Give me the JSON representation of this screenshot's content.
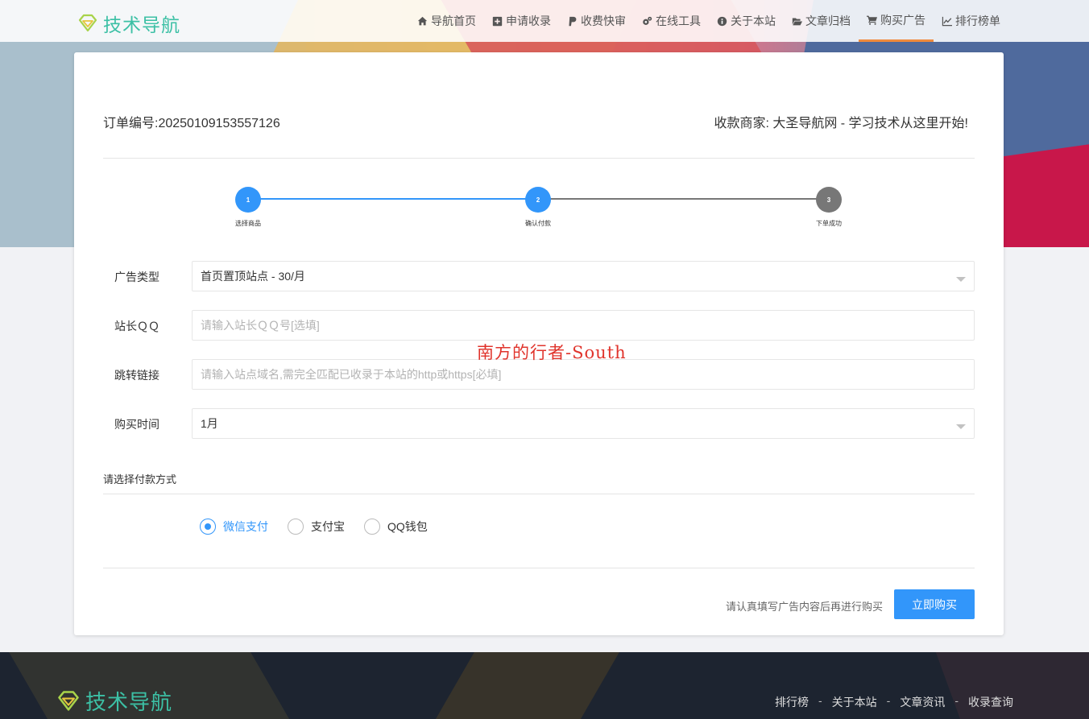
{
  "brand": {
    "name": "技术导航"
  },
  "nav": {
    "items": [
      {
        "label": "导航首页",
        "icon": "home-icon"
      },
      {
        "label": "申请收录",
        "icon": "plus-square-icon"
      },
      {
        "label": "收费快审",
        "icon": "paypal-icon"
      },
      {
        "label": "在线工具",
        "icon": "gears-icon"
      },
      {
        "label": "关于本站",
        "icon": "info-circle-icon"
      },
      {
        "label": "文章归档",
        "icon": "folder-open-icon"
      },
      {
        "label": "购买广告",
        "icon": "shopping-cart-icon",
        "active": true
      },
      {
        "label": "排行榜单",
        "icon": "line-chart-icon"
      }
    ]
  },
  "order": {
    "number": "订单编号:20250109153557126",
    "merchant": "收款商家: 大圣导航网 - 学习技术从这里开始!"
  },
  "steps": [
    {
      "num": "1",
      "label": "选择商品",
      "done": true
    },
    {
      "num": "2",
      "label": "确认付款",
      "done": true
    },
    {
      "num": "3",
      "label": "下单成功",
      "done": false
    }
  ],
  "form": {
    "ad_type": {
      "label": "广告类型",
      "value": "首页置顶站点 - 30/月"
    },
    "qq": {
      "label": "站长ＱＱ",
      "placeholder": "请输入站长ＱＱ号[选填]"
    },
    "link": {
      "label": "跳转链接",
      "placeholder": "请输入站点域名,需完全匹配已收录于本站的http或https[必填]"
    },
    "duration": {
      "label": "购买时间",
      "value": "1月"
    }
  },
  "payment": {
    "title": "请选择付款方式",
    "options": [
      {
        "label": "微信支付",
        "checked": true
      },
      {
        "label": "支付宝",
        "checked": false
      },
      {
        "label": "QQ钱包",
        "checked": false
      }
    ]
  },
  "submit": {
    "hint": "请认真填写广告内容后再进行购买",
    "button": "立即购买"
  },
  "watermark": "南方的行者-South",
  "footer": {
    "links": [
      "排行榜",
      "关于本站",
      "文章资讯",
      "收录查询"
    ],
    "separator": "-"
  },
  "colors": {
    "accent": "#3296fa",
    "brand": "#3cc0a5",
    "nav_active_underline": "#f08a3c",
    "step_pending": "#777777",
    "footer_bg": "#1d2430"
  }
}
